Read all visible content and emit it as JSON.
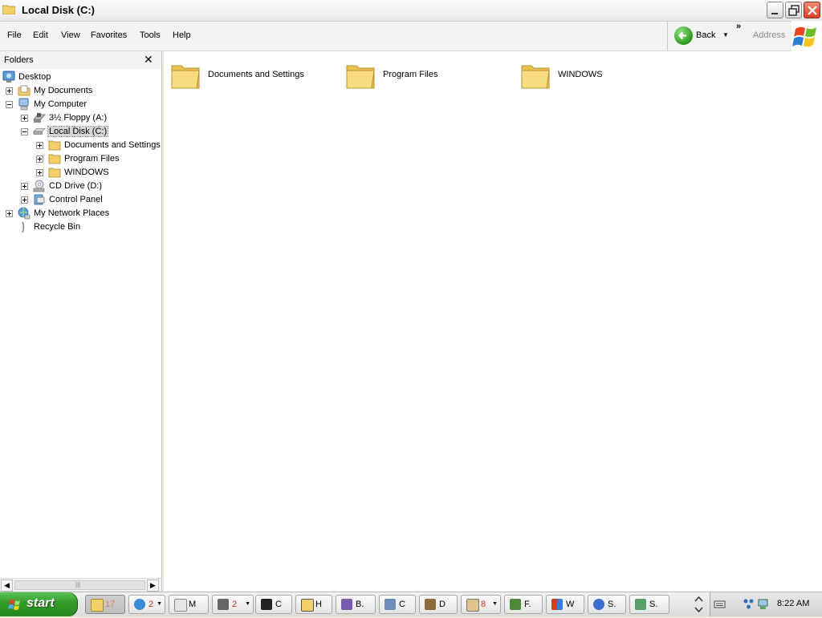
{
  "window": {
    "title": "Local Disk (C:)",
    "controls": [
      "minimize-icon",
      "restore-icon",
      "close-icon"
    ]
  },
  "menu": {
    "items": [
      "File",
      "Edit",
      "View",
      "Favorites",
      "Tools",
      "Help"
    ]
  },
  "toolbar": {
    "back_label": "Back",
    "chevron": "»",
    "address_label": "Address"
  },
  "folders_pane": {
    "title": "Folders",
    "close": "✕",
    "tree": [
      {
        "label": "Desktop",
        "icon": "desktop-icon"
      },
      {
        "label": "My Documents",
        "icon": "my-documents-icon"
      },
      {
        "label": "My Computer",
        "icon": "my-computer-icon"
      },
      {
        "label": "3½ Floppy (A:)",
        "icon": "floppy-drive-icon"
      },
      {
        "label": "Local Disk (C:)",
        "icon": "hard-disk-icon",
        "selected": true
      },
      {
        "label": "Documents and Settings",
        "icon": "folder-icon"
      },
      {
        "label": "Program Files",
        "icon": "folder-icon"
      },
      {
        "label": "WINDOWS",
        "icon": "folder-icon"
      },
      {
        "label": "CD Drive (D:)",
        "icon": "cd-drive-icon"
      },
      {
        "label": "Control Panel",
        "icon": "control-panel-icon"
      },
      {
        "label": "My Network Places",
        "icon": "network-places-icon"
      },
      {
        "label": "Recycle Bin",
        "icon": "recycle-bin-icon"
      }
    ]
  },
  "content": {
    "items": [
      {
        "name": "Documents and Settings",
        "icon": "folder-icon"
      },
      {
        "name": "Program Files",
        "icon": "folder-icon"
      },
      {
        "name": "WINDOWS",
        "icon": "folder-icon"
      }
    ]
  },
  "taskbar": {
    "start_label": "start",
    "tasks": [
      {
        "label": "",
        "count": "17",
        "icon": "explorer-folder-icon",
        "active": true
      },
      {
        "label": "",
        "count": "2",
        "icon": "internet-explorer-icon"
      },
      {
        "label": "M",
        "icon": "notepad-icon"
      },
      {
        "label": "",
        "count": "2",
        "icon": "raccoon-icon"
      },
      {
        "label": "C",
        "icon": "7zip-icon"
      },
      {
        "label": "H",
        "icon": "help-file-icon"
      },
      {
        "label": "B.",
        "icon": "b-app-icon"
      },
      {
        "label": "C",
        "icon": "c-app-icon"
      },
      {
        "label": "D",
        "icon": "d-app-icon"
      },
      {
        "label": "",
        "count": "8",
        "icon": "clipboard-icon"
      },
      {
        "label": "F.",
        "icon": "f-app-icon"
      },
      {
        "label": "W",
        "icon": "security-shield-icon"
      },
      {
        "label": "S.",
        "icon": "help-question-icon"
      },
      {
        "label": "S.",
        "icon": "s-app-icon"
      }
    ],
    "clock": "8:22 AM"
  },
  "colors": {
    "start_green": "#2f9a27",
    "selection_gray": "#d6d6d6",
    "folder_yellow": "#f5d77a",
    "badge_red": "#d63a2a"
  }
}
